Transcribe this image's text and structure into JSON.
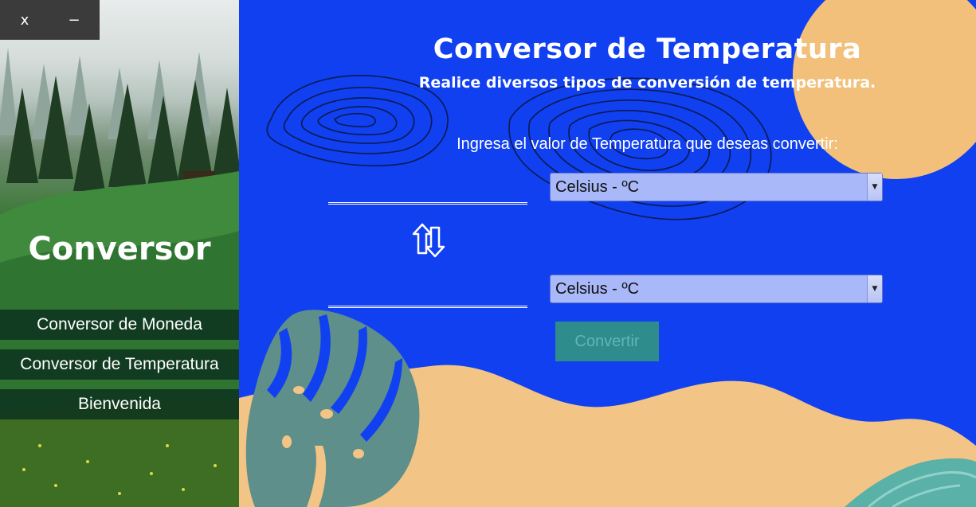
{
  "window_controls": {
    "close_label": "x",
    "minimize_label": "−"
  },
  "sidebar": {
    "brand": "Conversor",
    "items": [
      {
        "label": "Conversor de Moneda"
      },
      {
        "label": "Conversor de Temperatura"
      },
      {
        "label": "Bienvenida"
      }
    ]
  },
  "main": {
    "title": "Conversor de Temperatura",
    "subtitle": "Realice diversos tipos de conversión de temperatura.",
    "prompt": "Ingresa el valor de Temperatura que deseas convertir:",
    "input_value": "",
    "output_value": "",
    "from_unit": "Celsius - ºC",
    "to_unit": "Celsius - ºC",
    "convert_label": "Convertir",
    "swap_icon": "swap-arrows-icon"
  },
  "colors": {
    "background": "#1040f0",
    "sand": "#f2c586",
    "leaf": "#5e8f8a",
    "button": "#2e8c8c",
    "select": "#a8b8f8",
    "nav_item": "#0c301e"
  }
}
